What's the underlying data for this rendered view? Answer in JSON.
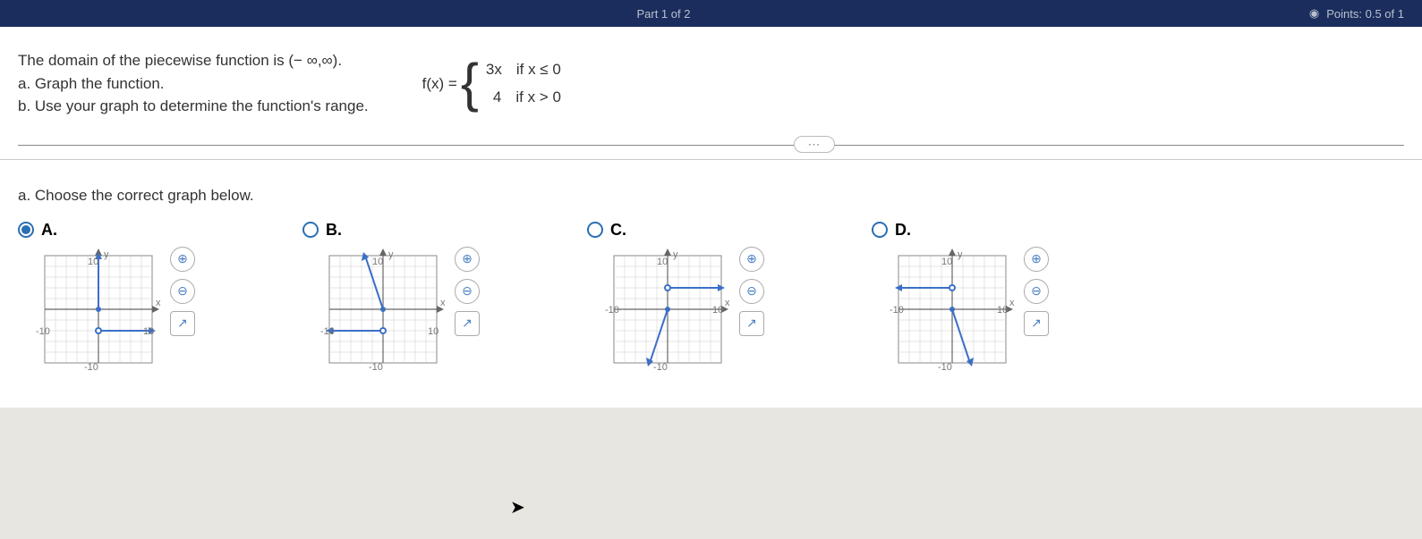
{
  "topbar": {
    "center": "Part 1 of 2",
    "right": "Points: 0.5 of 1"
  },
  "question": {
    "intro": "The domain of the piecewise function is (− ∞,∞).",
    "partA": "a. Graph the function.",
    "partB": "b. Use your graph to determine the function's range.",
    "funcLabel": "f(x) =",
    "case1_expr": "3x",
    "case1_cond": "if  x ≤ 0",
    "case2_expr": "4",
    "case2_cond": "if  x > 0",
    "ellipsis": "⋯"
  },
  "prompt": "a. Choose the correct graph below.",
  "options": {
    "A": {
      "label": "A."
    },
    "B": {
      "label": "B."
    },
    "C": {
      "label": "C."
    },
    "D": {
      "label": "D."
    }
  },
  "axis": {
    "y": "y",
    "x": "x",
    "p10": "10",
    "n10": "-10"
  },
  "chart_data": [
    {
      "option": "A",
      "type": "piecewise",
      "xlim": [
        -10,
        10
      ],
      "ylim": [
        -10,
        10
      ],
      "segments": [
        {
          "kind": "ray",
          "from": [
            0,
            10
          ],
          "to": [
            0,
            0
          ],
          "endpoint_closed": true,
          "direction": "up"
        },
        {
          "kind": "ray",
          "from": [
            0,
            -4
          ],
          "to": [
            10,
            -4
          ],
          "endpoint_open": true
        }
      ]
    },
    {
      "option": "B",
      "type": "piecewise",
      "xlim": [
        -10,
        10
      ],
      "ylim": [
        -10,
        10
      ],
      "segments": [
        {
          "kind": "line",
          "from": [
            -3.33,
            10
          ],
          "to": [
            0,
            0
          ],
          "endpoint_closed": true
        },
        {
          "kind": "ray",
          "from": [
            0,
            -4
          ],
          "to": [
            -10,
            -4
          ],
          "endpoint_open": true
        }
      ]
    },
    {
      "option": "C",
      "type": "piecewise",
      "xlim": [
        -10,
        10
      ],
      "ylim": [
        -10,
        10
      ],
      "segments": [
        {
          "kind": "line",
          "from": [
            -3.33,
            -10
          ],
          "to": [
            0,
            0
          ],
          "endpoint_closed": true
        },
        {
          "kind": "ray",
          "from": [
            0,
            4
          ],
          "to": [
            10,
            4
          ],
          "endpoint_open": true
        }
      ]
    },
    {
      "option": "D",
      "type": "piecewise",
      "xlim": [
        -10,
        10
      ],
      "ylim": [
        -10,
        10
      ],
      "segments": [
        {
          "kind": "line",
          "from": [
            3.33,
            -10
          ],
          "to": [
            0,
            0
          ],
          "endpoint_closed": true
        },
        {
          "kind": "ray",
          "from": [
            0,
            4
          ],
          "to": [
            -10,
            4
          ],
          "endpoint_open": true
        }
      ]
    }
  ]
}
